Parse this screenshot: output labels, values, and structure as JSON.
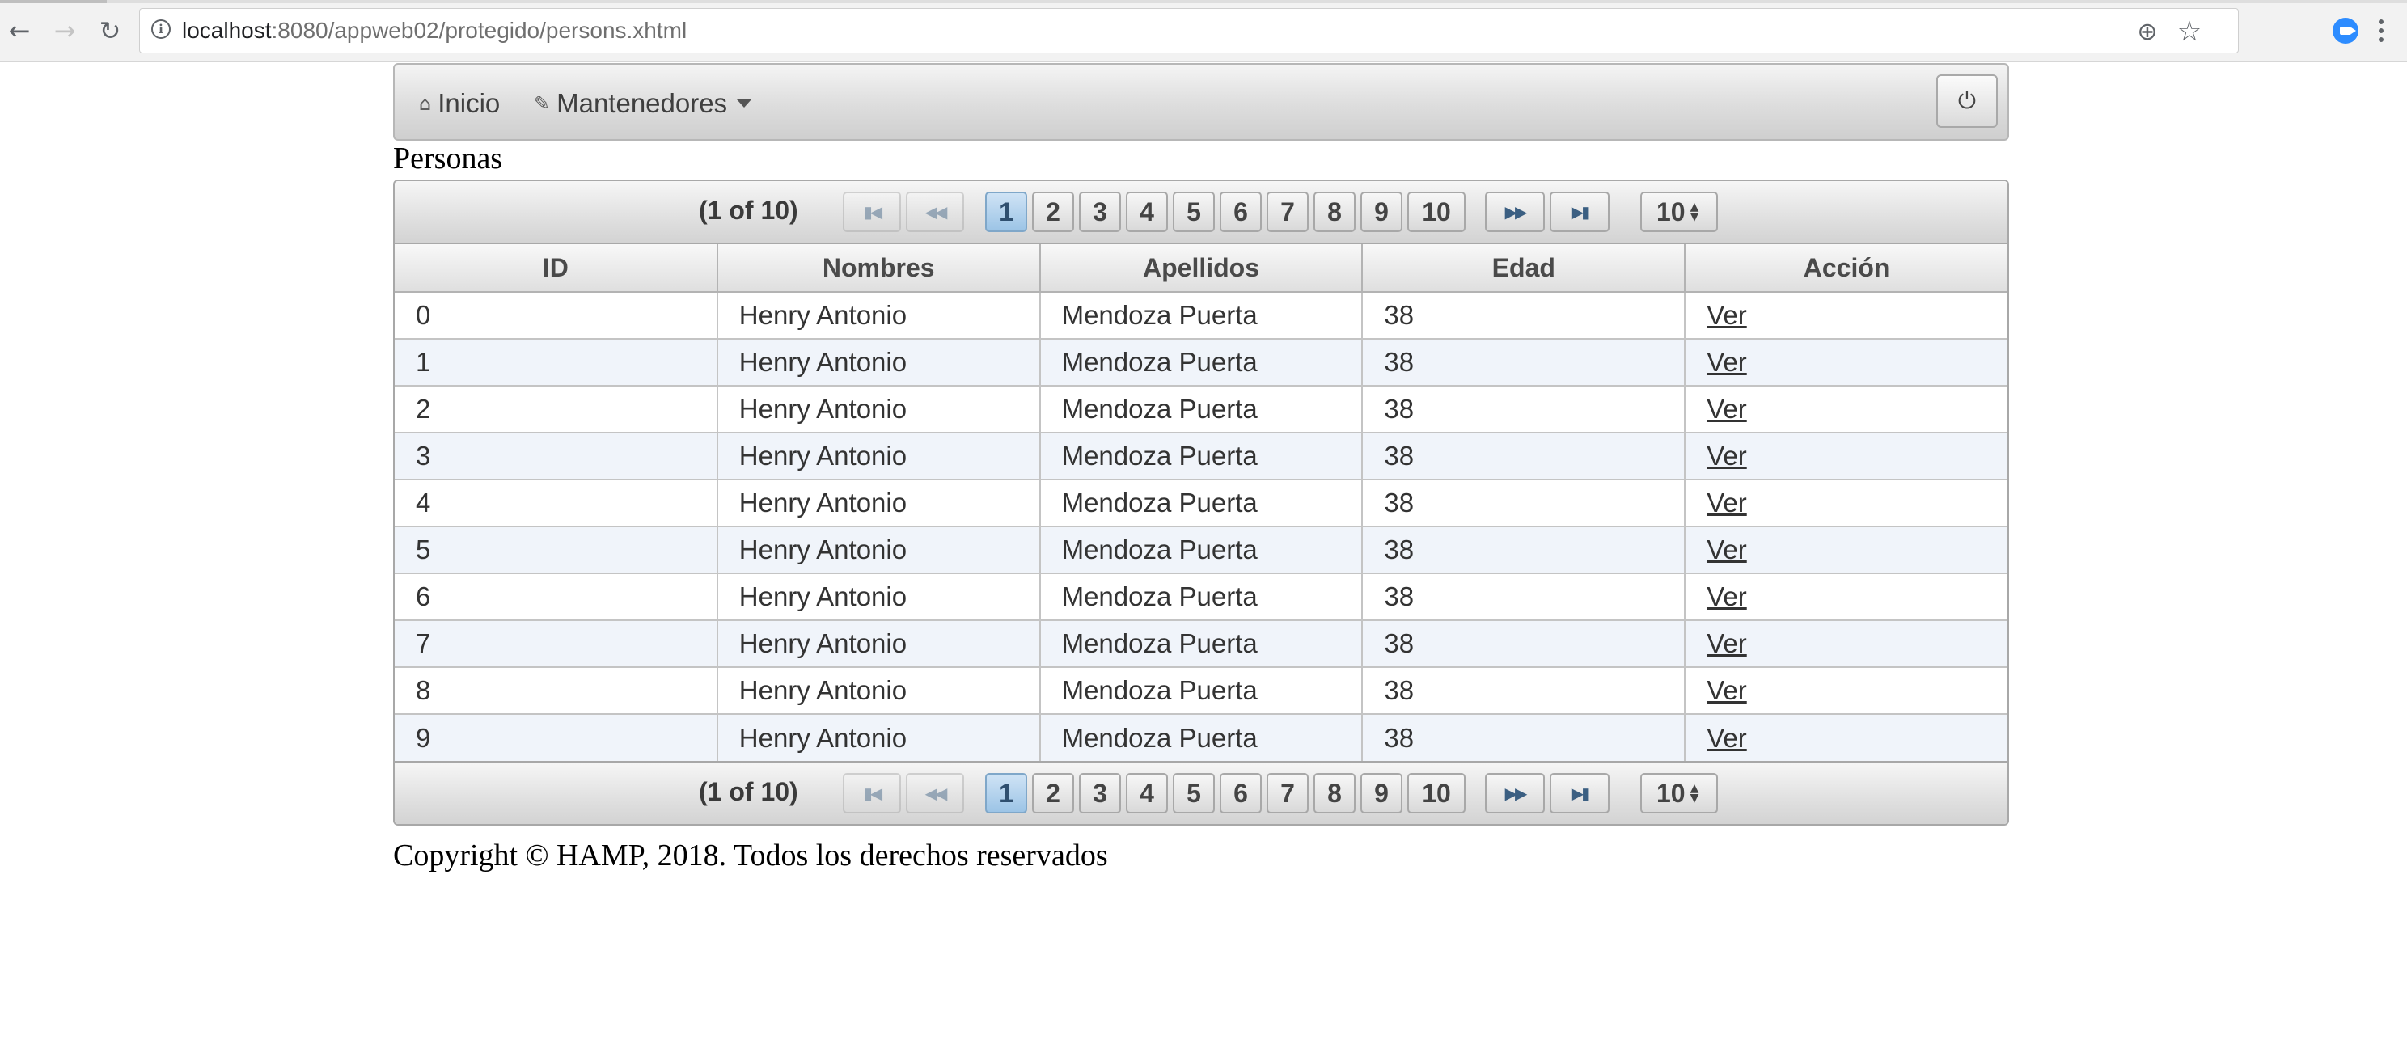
{
  "browser": {
    "url_host": "localhost",
    "url_path": ":8080/appweb02/protegido/persons.xhtml"
  },
  "menubar": {
    "items": [
      {
        "label": "Inicio",
        "icon": "home-icon"
      },
      {
        "label": "Mantenedores",
        "icon": "pencil-icon",
        "has_dropdown": true
      }
    ],
    "logout_icon": "power-icon"
  },
  "page": {
    "title": "Personas",
    "footer": "Copyright © HAMP, 2018. Todos los derechos reservados"
  },
  "table": {
    "columns": [
      "ID",
      "Nombres",
      "Apellidos",
      "Edad",
      "Acción"
    ],
    "rows": [
      {
        "id": "0",
        "nombres": "Henry Antonio",
        "apellidos": "Mendoza Puerta",
        "edad": "38",
        "accion": "Ver"
      },
      {
        "id": "1",
        "nombres": "Henry Antonio",
        "apellidos": "Mendoza Puerta",
        "edad": "38",
        "accion": "Ver"
      },
      {
        "id": "2",
        "nombres": "Henry Antonio",
        "apellidos": "Mendoza Puerta",
        "edad": "38",
        "accion": "Ver"
      },
      {
        "id": "3",
        "nombres": "Henry Antonio",
        "apellidos": "Mendoza Puerta",
        "edad": "38",
        "accion": "Ver"
      },
      {
        "id": "4",
        "nombres": "Henry Antonio",
        "apellidos": "Mendoza Puerta",
        "edad": "38",
        "accion": "Ver"
      },
      {
        "id": "5",
        "nombres": "Henry Antonio",
        "apellidos": "Mendoza Puerta",
        "edad": "38",
        "accion": "Ver"
      },
      {
        "id": "6",
        "nombres": "Henry Antonio",
        "apellidos": "Mendoza Puerta",
        "edad": "38",
        "accion": "Ver"
      },
      {
        "id": "7",
        "nombres": "Henry Antonio",
        "apellidos": "Mendoza Puerta",
        "edad": "38",
        "accion": "Ver"
      },
      {
        "id": "8",
        "nombres": "Henry Antonio",
        "apellidos": "Mendoza Puerta",
        "edad": "38",
        "accion": "Ver"
      },
      {
        "id": "9",
        "nombres": "Henry Antonio",
        "apellidos": "Mendoza Puerta",
        "edad": "38",
        "accion": "Ver"
      }
    ]
  },
  "paginator": {
    "current_report": "(1 of 10)",
    "pages": [
      "1",
      "2",
      "3",
      "4",
      "5",
      "6",
      "7",
      "8",
      "9",
      "10"
    ],
    "active_page": "1",
    "rows_per_page": "10",
    "nav_icons": [
      "first-page-icon",
      "prev-page-icon",
      "next-page-icon",
      "last-page-icon"
    ]
  }
}
